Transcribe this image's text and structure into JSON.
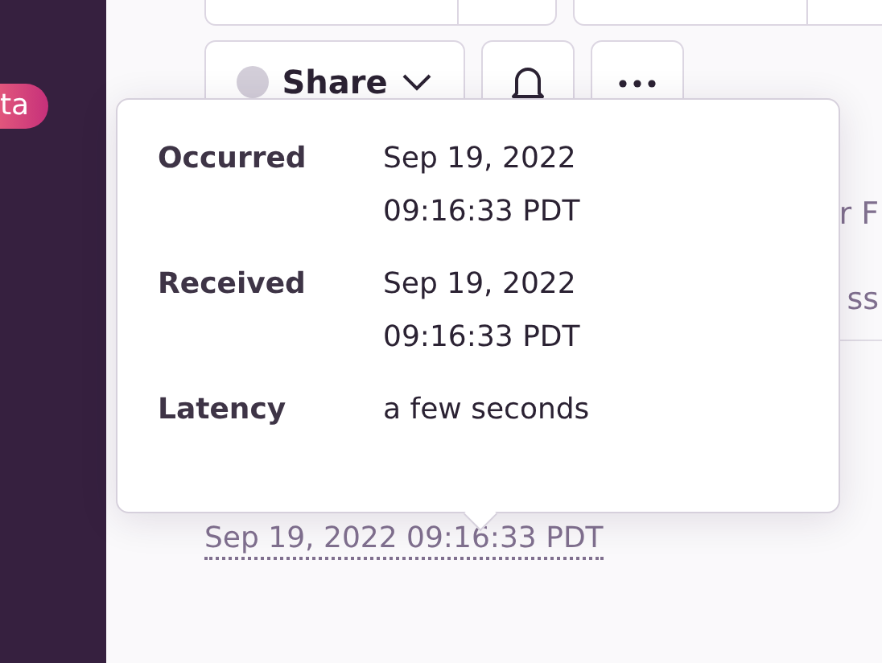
{
  "sidebar": {
    "badge": "ta"
  },
  "actions": {
    "share": {
      "label": "Share"
    }
  },
  "background_fragments": [
    "r F",
    "ss"
  ],
  "popover": {
    "rows": [
      {
        "label": "Occurred",
        "value_lines": [
          "Sep 19, 2022",
          "09:16:33 PDT"
        ]
      },
      {
        "label": "Received",
        "value_lines": [
          "Sep 19, 2022",
          "09:16:33 PDT"
        ]
      },
      {
        "label": "Latency",
        "value_lines": [
          "a few seconds"
        ]
      }
    ]
  },
  "timestamp": "Sep 19, 2022 09:16:33 PDT"
}
